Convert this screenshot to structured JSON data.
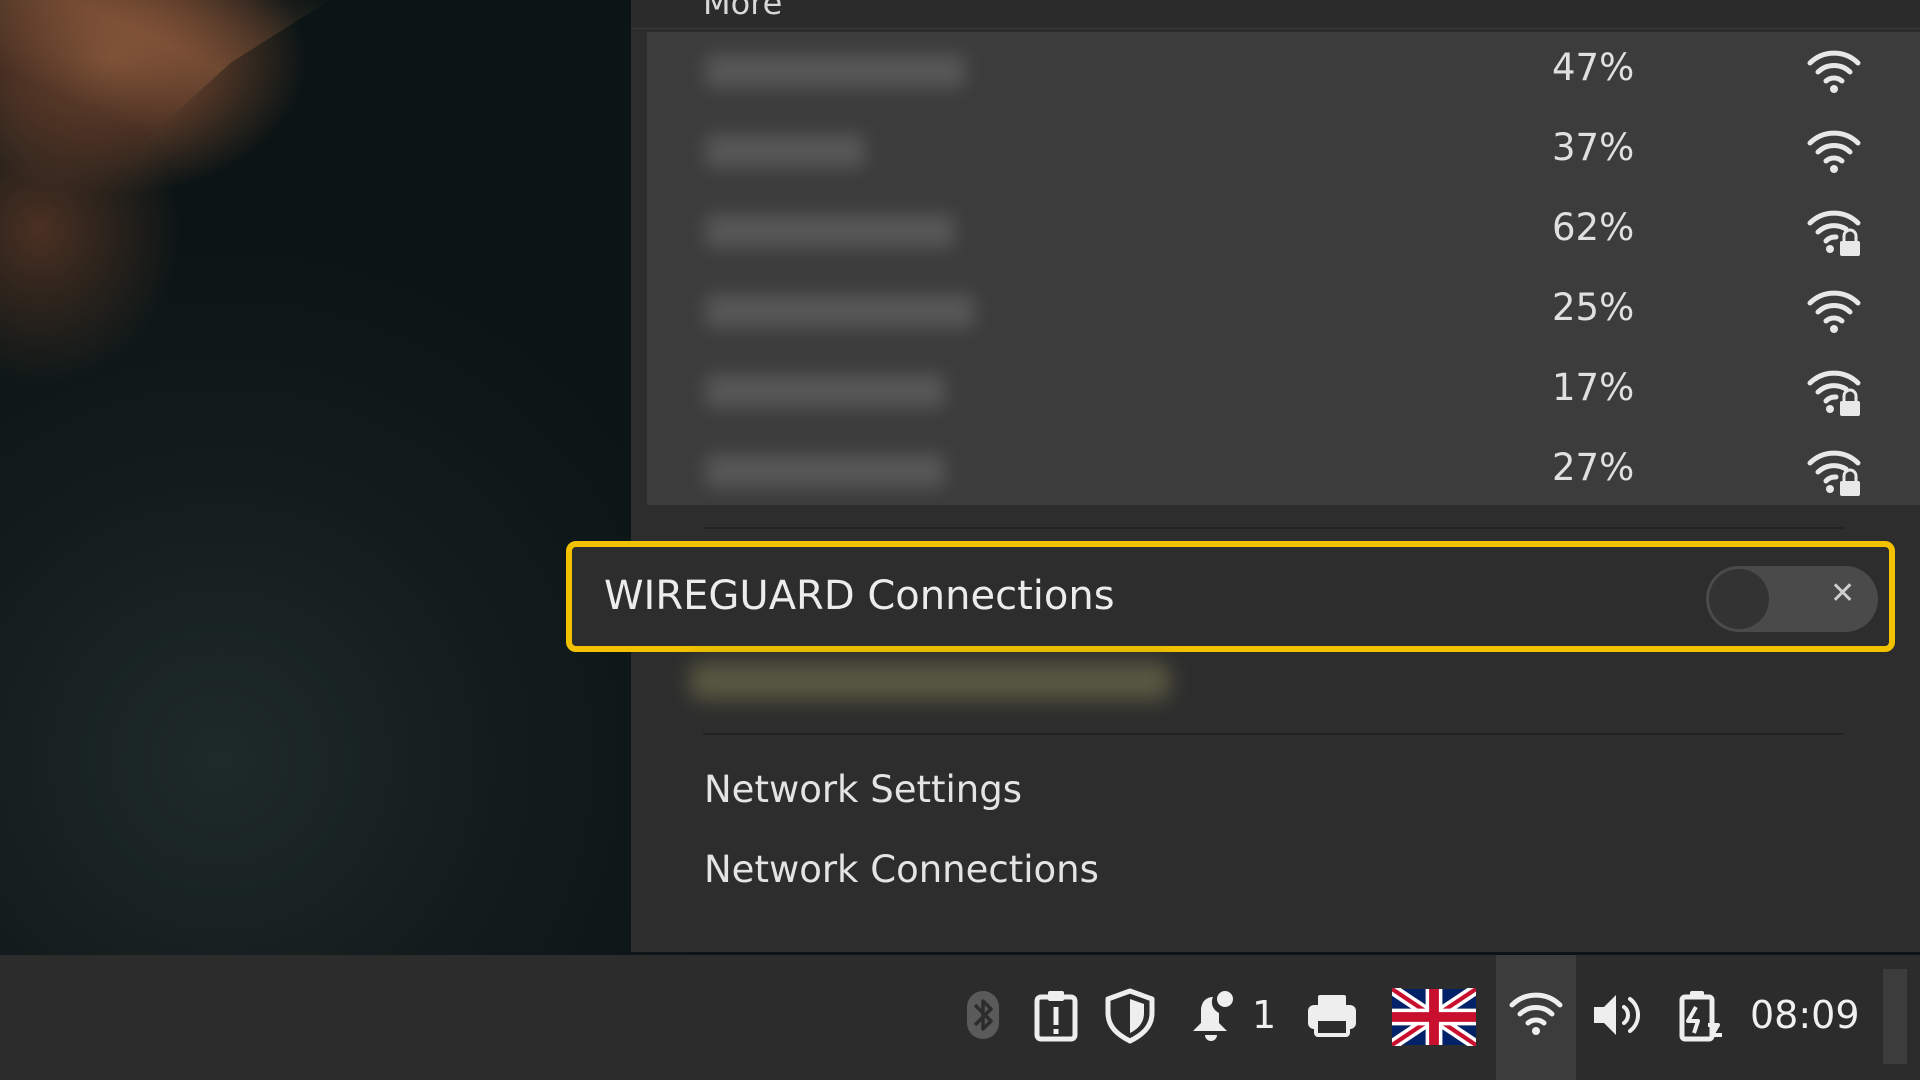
{
  "menu": {
    "header_label": "More",
    "wifi_networks": [
      {
        "signal": "47%",
        "secured": false
      },
      {
        "signal": "37%",
        "secured": false
      },
      {
        "signal": "62%",
        "secured": true
      },
      {
        "signal": "25%",
        "secured": false
      },
      {
        "signal": "17%",
        "secured": true
      },
      {
        "signal": "27%",
        "secured": true
      }
    ],
    "wireguard": {
      "label": "WIREGUARD Connections",
      "toggle_state": "off",
      "toggle_off_glyph": "✕"
    },
    "items": [
      {
        "label": "Network Settings"
      },
      {
        "label": "Network Connections"
      }
    ]
  },
  "panel": {
    "notification_count": "1",
    "clock": "08:09",
    "tray_icons": [
      "bluetooth-icon",
      "clipboard-icon",
      "shield-icon",
      "notification-bell-icon",
      "printer-icon",
      "uk-flag-keyboard-layout-icon",
      "wifi-icon",
      "volume-icon",
      "battery-charging-icon"
    ]
  },
  "colors": {
    "highlight": "#f2c200",
    "menu_bg": "#2d2d2d",
    "wifi_list_bg": "#3c3c3c",
    "panel_bg": "#2c2c2c"
  }
}
